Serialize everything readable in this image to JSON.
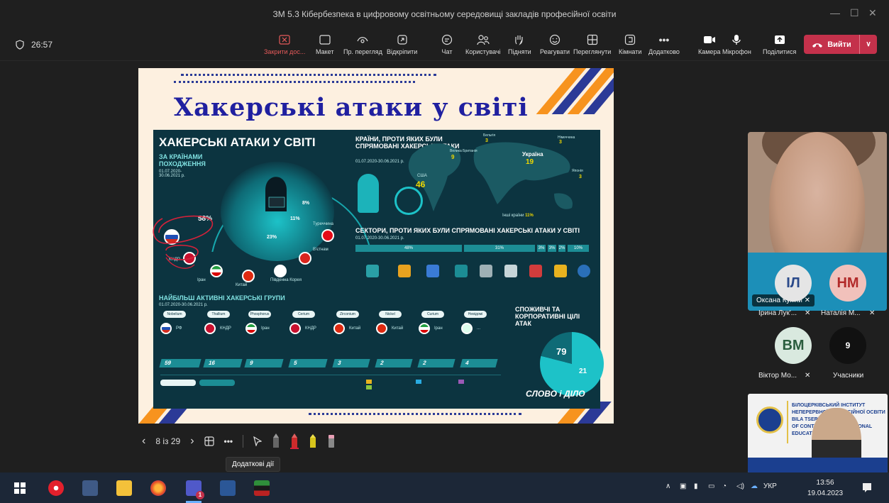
{
  "window": {
    "title": "ЗМ 5.3 Кібербезпека в цифровому освітньому середовищі закладів професійної освіти"
  },
  "meeting": {
    "timer": "26:57"
  },
  "toolbar": {
    "items": [
      {
        "label": "Закрити дос...",
        "icon": "close-share-icon"
      },
      {
        "label": "Макет",
        "icon": "layout-icon"
      },
      {
        "label": "Пр. перегляд",
        "icon": "preview-icon"
      },
      {
        "label": "Відкріпити",
        "icon": "unpin-icon"
      },
      {
        "label": "Чат",
        "icon": "chat-icon"
      },
      {
        "label": "Користувачі",
        "icon": "people-icon"
      },
      {
        "label": "Підняти",
        "icon": "raise-hand-icon"
      },
      {
        "label": "Реагувати",
        "icon": "react-icon"
      },
      {
        "label": "Переглянути",
        "icon": "view-icon"
      },
      {
        "label": "Кімнати",
        "icon": "rooms-icon"
      },
      {
        "label": "Додатково",
        "icon": "more-icon"
      },
      {
        "label": "Камера",
        "icon": "camera-icon"
      },
      {
        "label": "Мікрофон",
        "icon": "mic-icon"
      },
      {
        "label": "Поділитися",
        "icon": "share-icon"
      }
    ],
    "leave_label": "Вийти"
  },
  "slide": {
    "title": "Хакерські атаки у світі",
    "infographic": {
      "heading": "ХАКЕРСЬКІ АТАКИ У СВІТІ",
      "by_origin": "ЗА КРАЇНАМИ ПОХОДЖЕННЯ",
      "period": "01.07.2020-30.06.2021 р.",
      "origin_values": [
        "58%",
        "23%",
        "11%",
        "8%"
      ],
      "countries": [
        "РФ",
        "КНДР",
        "Іран",
        "Китай",
        "Південна Корея",
        "В'єтнам",
        "Туреччина"
      ],
      "targets_heading": "КРАЇНИ, ПРОТИ ЯКИХ БУЛИ СПРЯМОВАНІ ХАКЕРСЬКІ АТАКИ",
      "targets": [
        {
          "name": "США",
          "value": "46"
        },
        {
          "name": "Україна",
          "value": "19"
        },
        {
          "name": "Велика Британія",
          "value": "9"
        },
        {
          "name": "Бельгія",
          "value": "3"
        },
        {
          "name": "Німеччина",
          "value": "3"
        },
        {
          "name": "Японія",
          "value": "3"
        },
        {
          "name": "Інші країни",
          "value": "11%"
        }
      ],
      "sectors_heading": "СЕКТОРИ, ПРОТИ ЯКИХ БУЛИ СПРЯМОВАНІ ХАКЕРСЬКІ АТАКИ У СВІТІ",
      "sector_values": [
        "48%",
        "31%",
        "3%",
        "3%",
        "2%",
        "10%"
      ],
      "groups_heading": "НАЙБІЛЬШ АКТИВНІ ХАКЕРСЬКІ ГРУПИ",
      "groups": [
        {
          "name": "Nobelium",
          "country": "РФ",
          "value": "59"
        },
        {
          "name": "Thallium",
          "country": "КНДР",
          "value": "16"
        },
        {
          "name": "Phosphorus",
          "country": "Іран",
          "value": "9"
        },
        {
          "name": "Cerium",
          "country": "КНДР",
          "value": "5"
        },
        {
          "name": "Zirconium",
          "country": "Китай",
          "value": "3"
        },
        {
          "name": "Nickel",
          "country": "Китай",
          "value": "2"
        },
        {
          "name": "Curium",
          "country": "Іран",
          "value": "2"
        },
        {
          "name": "Невідомі групи",
          "country": "...",
          "value": "4"
        }
      ],
      "consumer_heading": "СПОЖИВЧІ ТА КОРПОРАТИВНІ ЦІЛІ АТАК",
      "corporate_value": "79",
      "consumer_value": "21",
      "brand": "СЛОВО і ДІЛО"
    }
  },
  "slide_nav": {
    "counter": "8 із 29",
    "tooltip": "Додаткові дії"
  },
  "participants": {
    "main_video_name": "Оксана Кухтій",
    "tiles": [
      {
        "initials": "ІЛ",
        "name": "Ірина Лук'...",
        "color": "#e5e5e5",
        "text_color": "#2b4a8a"
      },
      {
        "initials": "НМ",
        "name": "Наталія М...",
        "color": "#f1c1bb",
        "text_color": "#b22a2a"
      },
      {
        "initials": "ВМ",
        "name": "Віктор Мо...",
        "color": "#d9e9df",
        "text_color": "#2a5d3e"
      },
      {
        "initials": "9",
        "name": "Учасники",
        "color": "#111111",
        "text_color": "#ffffff"
      }
    ],
    "mini_banner": [
      "БІЛОЦЕРКІВСЬКИЙ ІНСТИТУТ",
      "НЕПЕРЕРВНОЇ ПРОФЕСІЙНОЇ ОСВІТИ",
      "BILA TSERKVA INSTITUTE",
      "OF CONTINUING PROFESSIONAL",
      "EDUCATION"
    ]
  },
  "taskbar": {
    "lang": "УКР",
    "time": "13:56",
    "date": "19.04.2023",
    "teams_badge": "1"
  }
}
